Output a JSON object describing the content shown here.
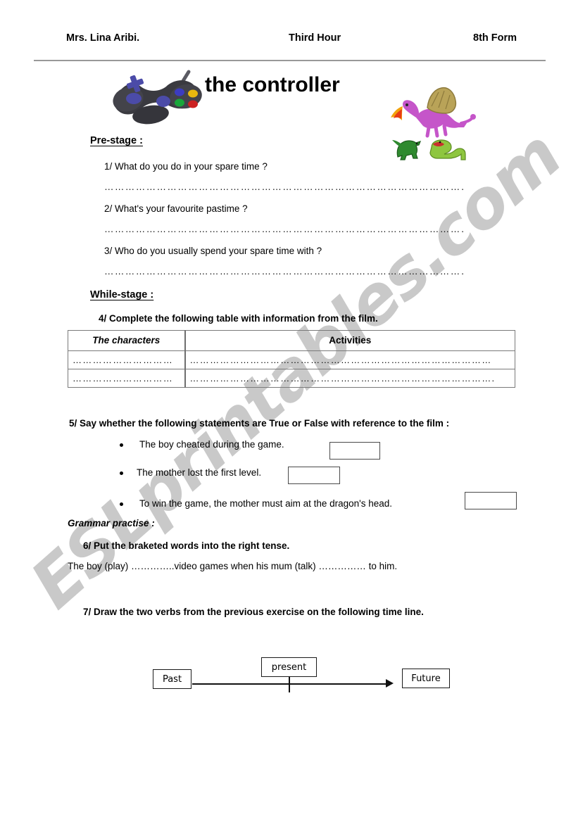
{
  "header": {
    "teacher": "Mrs. Lina Aribi.",
    "hour": "Third Hour",
    "form": "8th Form"
  },
  "title": "the controller",
  "artwork": {
    "controller_label": "game-controller-clipart",
    "dragon_label": "dragon-and-dinosaurs-clipart"
  },
  "watermark": {
    "text": "ESLprintables.com",
    "color": "#c9c9c9"
  },
  "prestage": {
    "heading": "Pre-stage :",
    "questions": [
      "1/ What do you do in your spare time ?",
      "2/ What's your favourite pastime ?",
      "3/ Who do you usually spend your spare time with ?"
    ],
    "answer_rule": "……………………………………………………………………………………………"
  },
  "whilestage": {
    "heading": "While-stage :",
    "task4": "4/ Complete the following table with information from the film.",
    "table": {
      "headers": [
        "The characters",
        "Activities"
      ],
      "rows": [
        [
          "…………………………",
          "………………………………………………………………………………"
        ],
        [
          "…………………………",
          "………………………………………………………………………………."
        ]
      ]
    },
    "task5": "5/ Say whether the following statements are True or False with reference to the film :",
    "statements": [
      "The boy cheated during the game.",
      "The mother lost the first level.",
      "To win the game, the mother must aim at the dragon's head."
    ]
  },
  "grammar": {
    "heading": "Grammar practise :",
    "task6": "6/ Put the braketed words into the right tense.",
    "sentence": "The boy (play) …………..video games when his mum (talk) …………… to him.",
    "task7": "7/ Draw the two verbs from the previous exercise on the following time line.",
    "timeline": {
      "past": "Past",
      "present": "present",
      "future": "Future"
    }
  }
}
